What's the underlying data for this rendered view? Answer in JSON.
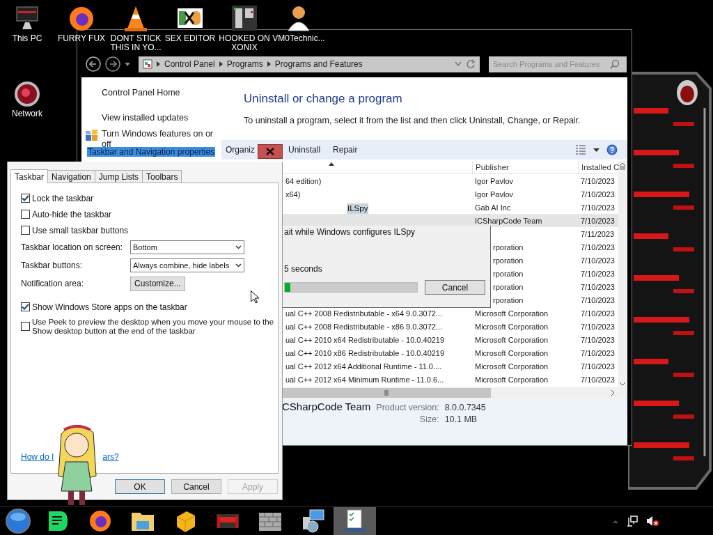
{
  "desktop_icons": [
    {
      "label": "This PC",
      "kind": "computer"
    },
    {
      "label": "FURRY FUX",
      "kind": "browser"
    },
    {
      "label": "DONT STICK THIS IN YO...",
      "kind": "cone"
    },
    {
      "label": "SEX EDITOR",
      "kind": "editor"
    },
    {
      "label": "HOOKED ON XONIX",
      "kind": "game"
    },
    {
      "label": "VM0Technic...",
      "kind": "person"
    },
    {
      "label": "Network",
      "kind": "network"
    }
  ],
  "control_panel": {
    "address_path": [
      "Control Panel",
      "Programs",
      "Programs and Features"
    ],
    "search": {
      "placeholder": "Search Programs and Features"
    },
    "left_links": [
      "Control Panel Home",
      "View installed updates",
      "Turn Windows features on or off"
    ],
    "heading": "Uninstall or change a program",
    "description": "To uninstall a program, select it from the list and then click Uninstall, Change, or Repair.",
    "toolbar": [
      "Organiz",
      "Uninstall",
      "Repair"
    ],
    "columns": [
      "Publisher",
      "Installed C"
    ],
    "rows": [
      {
        "name": "64 edition)",
        "publisher": "Igor Pavlov",
        "installed": "7/10/2023",
        "selected": false,
        "kind": "visible"
      },
      {
        "name": "x64)",
        "publisher": "Igor Pavlov",
        "installed": "7/10/2023",
        "selected": false,
        "kind": "visible"
      },
      {
        "publisher": "Gab AI Inc",
        "installed": "7/10/2023",
        "selected": false,
        "kind": "visible"
      },
      {
        "publisher": "ICSharpCode Team",
        "installed": "7/10/2023",
        "selected": true,
        "kind": "visible"
      },
      {
        "installed": "7/11/2023",
        "selected": false,
        "kind": "visible"
      },
      {
        "publisher": "rporation",
        "installed": "7/10/2023",
        "selected": false,
        "kind": "covered"
      },
      {
        "publisher": "rporation",
        "installed": "7/10/2023",
        "selected": false,
        "kind": "covered"
      },
      {
        "publisher": "rporation",
        "installed": "7/10/2023",
        "selected": false,
        "kind": "covered"
      },
      {
        "publisher": "rporation",
        "installed": "7/10/2023",
        "selected": false,
        "kind": "covered"
      },
      {
        "publisher": "rporation",
        "installed": "7/10/2023",
        "selected": false,
        "kind": "covered"
      },
      {
        "name": "ual C++ 2008 Redistributable - x64 9.0.3072...",
        "publisher": "Microsoft Corporation",
        "installed": "7/10/2023",
        "selected": false,
        "kind": "visible"
      },
      {
        "name": "ual C++ 2008 Redistributable - x86 9.0.3072...",
        "publisher": "Microsoft Corporation",
        "installed": "7/10/2023",
        "selected": false,
        "kind": "visible"
      },
      {
        "name": "ual C++ 2010  x64 Redistributable - 10.0.40219",
        "publisher": "Microsoft Corporation",
        "installed": "7/10/2023",
        "selected": false,
        "kind": "visible"
      },
      {
        "name": "ual C++ 2010  x86 Redistributable - 10.0.40219",
        "publisher": "Microsoft Corporation",
        "installed": "7/10/2023",
        "selected": false,
        "kind": "visible"
      },
      {
        "name": "ual C++ 2012 x64 Additional Runtime - 11.0....",
        "publisher": "Microsoft Corporation",
        "installed": "7/10/2023",
        "selected": false,
        "kind": "visible"
      },
      {
        "name": "ual C++ 2012 x64 Minimum Runtime - 11.0.6...",
        "publisher": "Microsoft Corporation",
        "installed": "7/10/2023",
        "selected": false,
        "kind": "visible"
      }
    ],
    "details": {
      "publisher": "CSharpCode Team",
      "version_label": "Product version:",
      "version": "8.0.0.7345",
      "size_label": "Size:",
      "size": "10.1 MB"
    }
  },
  "progress_dialog": {
    "title": "ILSpy",
    "message": "ait while Windows configures ILSpy",
    "time_left": "5 seconds",
    "level": 0.04,
    "button": "Cancel"
  },
  "taskbar_dialog": {
    "title": "Taskbar and Navigation properties",
    "tabs": [
      {
        "label": "Taskbar",
        "selected": true
      },
      {
        "label": "Navigation",
        "selected": false
      },
      {
        "label": "Jump Lists",
        "selected": false
      },
      {
        "label": "Toolbars",
        "selected": false
      }
    ],
    "settings": [
      {
        "kind": "checkbox",
        "label": "Lock the taskbar",
        "checked": true
      },
      {
        "kind": "checkbox",
        "label": "Auto-hide the taskbar",
        "checked": false
      },
      {
        "kind": "checkbox",
        "label": "Use small taskbar buttons",
        "checked": false
      },
      {
        "kind": "dropdown",
        "label": "Taskbar location on screen:",
        "value": "Bottom"
      },
      {
        "kind": "dropdown",
        "label": "Taskbar buttons:",
        "value": "Always combine, hide labels"
      },
      {
        "kind": "button",
        "label": "Notification area:",
        "button": "Customize..."
      },
      {
        "kind": "checkbox",
        "label": "Show Windows Store apps on the taskbar",
        "checked": true
      },
      {
        "kind": "checkbox",
        "label": "Use Peek to preview the desktop when you move your mouse to the Show desktop button at the end of the taskbar",
        "checked": false
      }
    ],
    "help_link": [
      "How do I",
      "ars?"
    ],
    "buttons": [
      {
        "label": "OK",
        "disabled": false
      },
      {
        "label": "Cancel",
        "disabled": false
      },
      {
        "label": "Apply",
        "disabled": true
      }
    ]
  },
  "taskbar": {
    "items": [
      {
        "kind": "orb",
        "selected": false
      },
      {
        "kind": "notes",
        "selected": false
      },
      {
        "kind": "browser",
        "selected": false
      },
      {
        "kind": "folder",
        "selected": false
      },
      {
        "kind": "cube",
        "selected": false
      },
      {
        "kind": "gadget",
        "selected": false
      },
      {
        "kind": "wall",
        "selected": false
      },
      {
        "kind": "installer",
        "selected": false
      },
      {
        "kind": "checklist",
        "selected": true
      }
    ]
  }
}
